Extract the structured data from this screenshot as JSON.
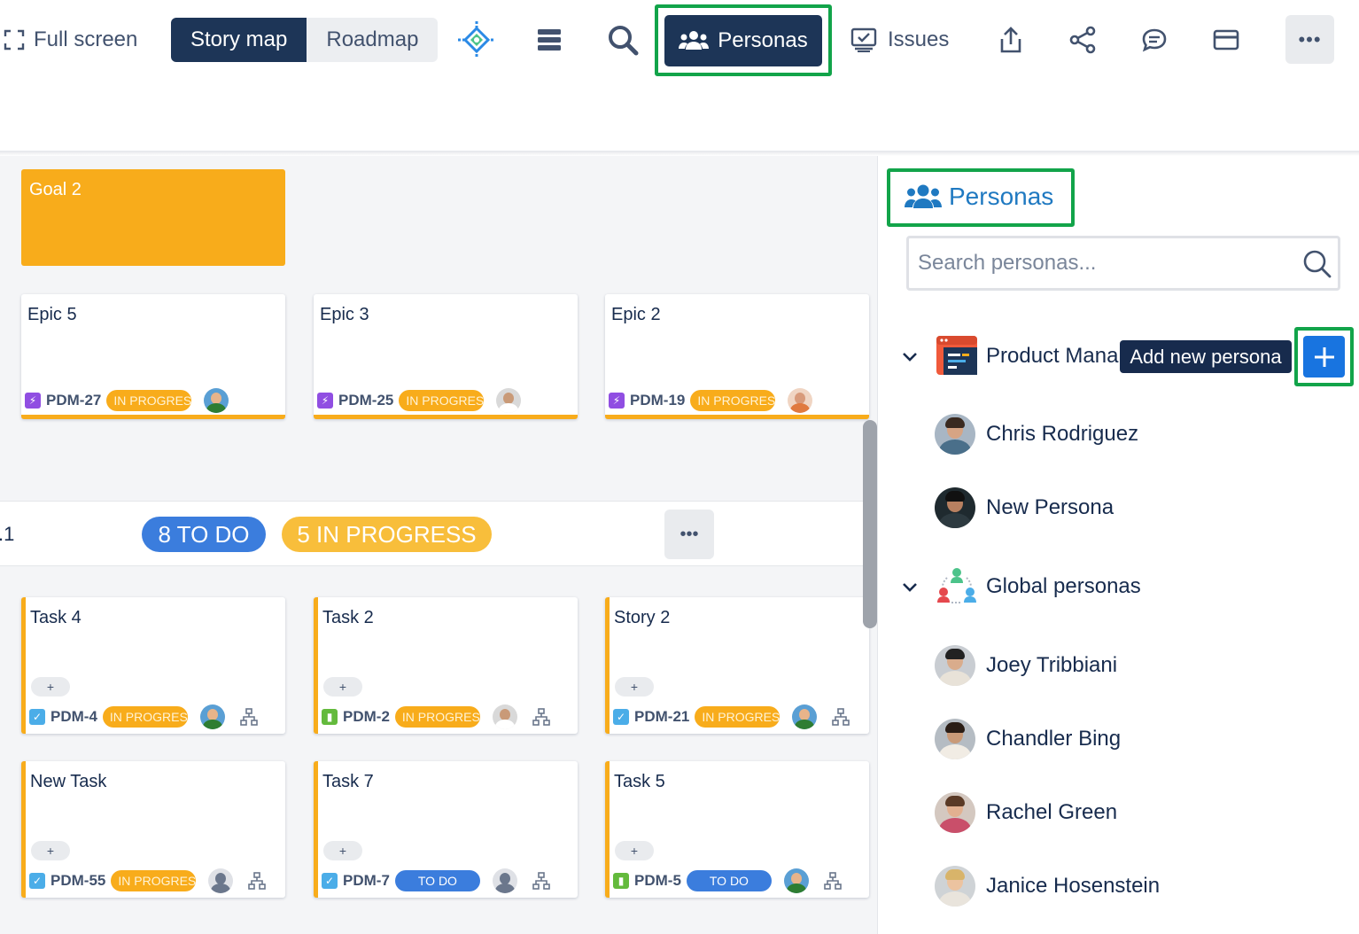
{
  "toolbar": {
    "fullscreen_label": "Full screen",
    "view_tabs": [
      {
        "label": "Story map",
        "active": true
      },
      {
        "label": "Roadmap",
        "active": false
      }
    ],
    "personas_button": "Personas",
    "issues_label": "Issues",
    "more_label": "•••"
  },
  "board": {
    "goal": {
      "title": "Goal 2",
      "color": "#f8ac1b"
    },
    "epics": [
      {
        "title": "Epic 5",
        "key": "PDM-27",
        "status": "IN PROGRESS"
      },
      {
        "title": "Epic 3",
        "key": "PDM-25",
        "status": "IN PROGRESS"
      },
      {
        "title": "Epic 2",
        "key": "PDM-19",
        "status": "IN PROGRESS"
      }
    ],
    "release": {
      "label": ".1",
      "todo_count": "8 TO DO",
      "inprogress_count": "5 IN PROGRESS",
      "more_label": "•••"
    },
    "tasks": [
      {
        "title": "Task 4",
        "key": "PDM-4",
        "type": "task",
        "status": "IN PROGRESS"
      },
      {
        "title": "Task 2",
        "key": "PDM-2",
        "type": "story",
        "status": "IN PROGRESS"
      },
      {
        "title": "Story 2",
        "key": "PDM-21",
        "type": "task",
        "status": "IN PROGRESS"
      },
      {
        "title": "New Task",
        "key": "PDM-55",
        "type": "task",
        "status": "IN PROGRESS"
      },
      {
        "title": "Task 7",
        "key": "PDM-7",
        "type": "task",
        "status": "TO DO"
      },
      {
        "title": "Task 5",
        "key": "PDM-5",
        "type": "story",
        "status": "TO DO"
      }
    ],
    "plus_label": "+",
    "status_colors": {
      "in_progress": "#f8ac1b",
      "todo": "#3b7ddd"
    }
  },
  "panel": {
    "title": "Personas",
    "search_placeholder": "Search personas...",
    "groups": [
      {
        "label": "Product Mana",
        "personas": [
          "Chris Rodriguez",
          "New Persona"
        ]
      },
      {
        "label": "Global personas",
        "personas": [
          "Joey Tribbiani",
          "Chandler Bing",
          "Rachel Green",
          "Janice Hosenstein"
        ]
      }
    ],
    "tooltip": "Add new persona",
    "accent": "#1f79c1",
    "highlight": "#12a44a"
  }
}
